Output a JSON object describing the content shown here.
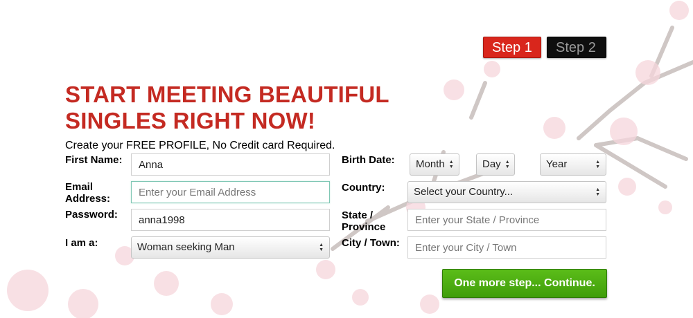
{
  "steps": {
    "step1": "Step 1",
    "step2": "Step 2"
  },
  "headline": {
    "line1": "START MEETING BEAUTIFUL",
    "line2": "SINGLES RIGHT NOW!"
  },
  "subline": "Create your FREE PROFILE, No Credit card Required.",
  "form": {
    "first_name": {
      "label": "First Name:",
      "value": "Anna"
    },
    "email": {
      "label_line1": "Email",
      "label_line2": "Address:",
      "value": "",
      "placeholder": "Enter your Email Address"
    },
    "password": {
      "label": "Password:",
      "value": "anna1998"
    },
    "seeking": {
      "label": "I am a:",
      "selected": "Woman seeking Man"
    },
    "birth_date": {
      "label": "Birth Date:",
      "month": "Month",
      "day": "Day",
      "year": "Year"
    },
    "country": {
      "label": "Country:",
      "selected": "Select your Country..."
    },
    "state": {
      "label_line1": "State /",
      "label_line2": "Province",
      "value": "",
      "placeholder": "Enter your State / Province"
    },
    "city": {
      "label": "City / Town:",
      "value": "",
      "placeholder": "Enter your City / Town"
    },
    "continue_label": "One more step... Continue."
  },
  "colors": {
    "headline": "#c42a22",
    "step_active": "#d9261c",
    "step_inactive": "#0e0e0e",
    "button": "#4aab12"
  }
}
